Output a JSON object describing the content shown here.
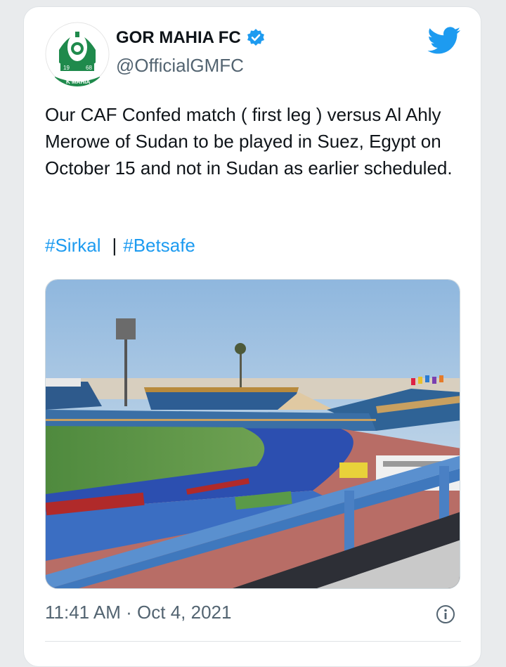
{
  "tweet": {
    "display_name": "GOR MAHIA FC",
    "handle": "@OfficialGMFC",
    "text": "Our CAF Confed match ( first leg ) versus Al Ahly Merowe of Sudan to be played in Suez, Egypt on October 15 and not in Sudan as earlier scheduled.",
    "hashtags": [
      "#Sirkal",
      "#Betsafe"
    ],
    "separator": "|",
    "timestamp": "11:41 AM · Oct 4, 2021"
  },
  "avatar": {
    "year_left": "19",
    "year_right": "68",
    "banner": "K MAHIA"
  },
  "colors": {
    "link": "#1d9bf0",
    "verified": "#1d9bf0",
    "text": "#0f1419",
    "muted": "#536471",
    "logo_green": "#1f8a4c"
  },
  "icons": {
    "verified": "verified-badge-icon",
    "bird": "twitter-bird-icon",
    "info": "info-icon"
  }
}
